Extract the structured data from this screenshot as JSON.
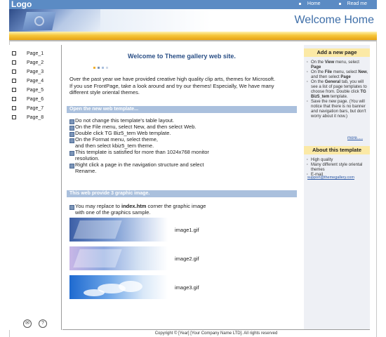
{
  "header": {
    "logo": "Logo",
    "nav": [
      {
        "label": "Home"
      },
      {
        "label": "Read me"
      }
    ],
    "welcome": "Welcome Home"
  },
  "sidebar": {
    "items": [
      {
        "label": "Page_1"
      },
      {
        "label": "Page_2"
      },
      {
        "label": "Page_3"
      },
      {
        "label": "Page_4"
      },
      {
        "label": "Page_5"
      },
      {
        "label": "Page_6"
      },
      {
        "label": "Page_7"
      },
      {
        "label": "Page_8"
      }
    ],
    "icons": [
      "mail-icon",
      "help-icon"
    ],
    "help_glyph": "?"
  },
  "main": {
    "title": "Welcome to Theme gallery web site.",
    "intro_1": "Over the past year we have provided creative high quality clip arts, themes for Microsoft.",
    "intro_2": "If you use FrontPage, take a look around and try our themes! Especially, We have many different style oriental themes.",
    "section1": "Open the new web template...",
    "steps": [
      {
        "text": "Do not change this template's table layout.",
        "sub": ""
      },
      {
        "text": "On the File menu, select New, and then select Web.",
        "sub": ""
      },
      {
        "text": "Double click TG Biz5_tem Web  template.",
        "sub": ""
      },
      {
        "text": "On the Format menu, select theme,",
        "sub": "and then select kbiz5_tem theme."
      },
      {
        "text": "This template is satisfied for more than 1024x768 monitor",
        "sub": "resolution."
      },
      {
        "text": "Right click a page in the navigation structure and select",
        "sub": "Rename."
      }
    ],
    "section2": "This web provide 3 graphic image.",
    "replace_pre": "You may replace to ",
    "replace_file": "index.htm",
    "replace_post": " corner the graphic image",
    "replace_sub": "with one of the  graphics sample.",
    "images": [
      {
        "label": "image1.gif"
      },
      {
        "label": "image2.gif"
      },
      {
        "label": "image3.gif"
      }
    ]
  },
  "right": {
    "add_title": "Add a new page",
    "add_steps": [
      {
        "pre": "On the ",
        "bold": "View",
        "post": " menu, select ",
        "bold2": "Page"
      },
      {
        "pre": "On the ",
        "bold": "File",
        "post": " menu, select ",
        "bold2": "New",
        "post2": ", and then select ",
        "bold3": "Page"
      },
      {
        "pre": "On the ",
        "bold": "General",
        "post": " tab, you will see a list of page templates to choose from.  Double click ",
        "bold2": "TG Biz5_tem",
        "post2": " template."
      },
      {
        "pre": "Save the new page. (You will notice that there is no banner and navigation bars, but don't worry about it now.)"
      }
    ],
    "more": "more.....",
    "about_title": "About this template",
    "about_items": [
      "High quality",
      "Many different style oriental themes",
      "E-mail"
    ],
    "email": "support@themegallery.com"
  },
  "footer": {
    "copyright": "Copyright © [Year] [Your Company Name LTD]. All rights reserved"
  },
  "colors": {
    "topbar": "#5b8bc4",
    "gold": "#f6c63a",
    "section": "#aac0dd",
    "title": "#2a4f86",
    "link": "#2b58a6",
    "right_bg": "#eef0f5",
    "right_head": "#fbe9a6"
  }
}
